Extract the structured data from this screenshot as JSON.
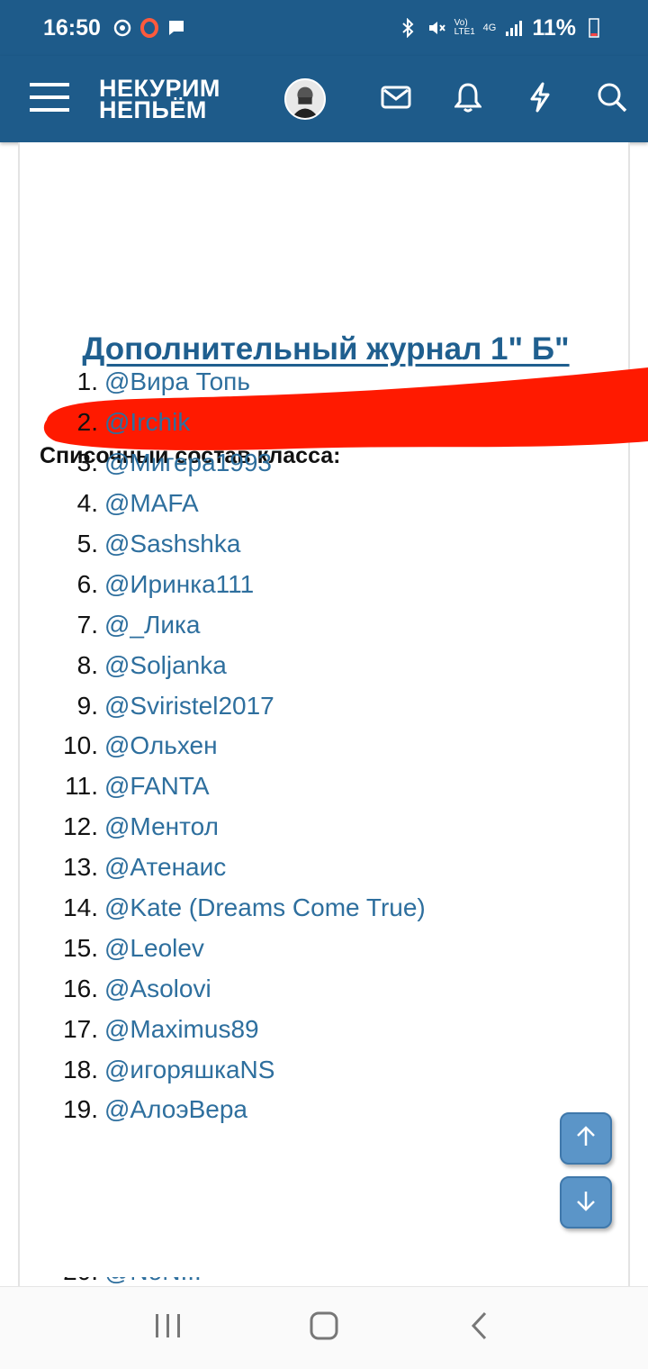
{
  "status_bar": {
    "time": "16:50",
    "battery": "11%",
    "network_label": "4G",
    "volte_label": "Vo) LTE1"
  },
  "header": {
    "logo_line1": "НЕКУРИМ",
    "logo_line2": "НЕПЬЁМ"
  },
  "content": {
    "title": "Дополнительный журнал 1\" Б\"",
    "section_label": "Списочный состав класса:",
    "members": [
      {
        "num": "1.",
        "name": "@Вира Топь"
      },
      {
        "num": "2.",
        "name": "@Irchik"
      },
      {
        "num": "3.",
        "name": "@Мигера1993"
      },
      {
        "num": "4.",
        "name": "@MAFA"
      },
      {
        "num": "5.",
        "name": "@Sashshka"
      },
      {
        "num": "6.",
        "name": "@Иринка111"
      },
      {
        "num": "7.",
        "name": "@_Лика"
      },
      {
        "num": "8.",
        "name": "@Soljanka"
      },
      {
        "num": "9.",
        "name": "@Sviristel2017"
      },
      {
        "num": "10.",
        "name": "@Ольхен"
      },
      {
        "num": "11.",
        "name": "@FANTA"
      },
      {
        "num": "12.",
        "name": "@Ментол"
      },
      {
        "num": "13.",
        "name": "@Атенаис"
      },
      {
        "num": "14.",
        "name": "@Kate (Dreams Come True)"
      },
      {
        "num": "15.",
        "name": "@Leolev"
      },
      {
        "num": "16.",
        "name": "@Asolovi"
      },
      {
        "num": "17.",
        "name": "@Maximus89"
      },
      {
        "num": "18.",
        "name": "@игоряшкаNS"
      },
      {
        "num": "19.",
        "name": "@АлоэВера"
      }
    ]
  },
  "colors": {
    "header_bg": "#1e5b8a",
    "link": "#2e6f9e",
    "title": "#1f5f8f",
    "redaction": "#ff1a00",
    "fab_bg": "#5b95c8"
  },
  "icons": {
    "menu": "hamburger-icon",
    "mail": "envelope-icon",
    "bell": "bell-icon",
    "lightning": "lightning-icon",
    "search": "search-icon",
    "scroll_up": "arrow-up-icon",
    "scroll_down": "arrow-down-icon"
  }
}
